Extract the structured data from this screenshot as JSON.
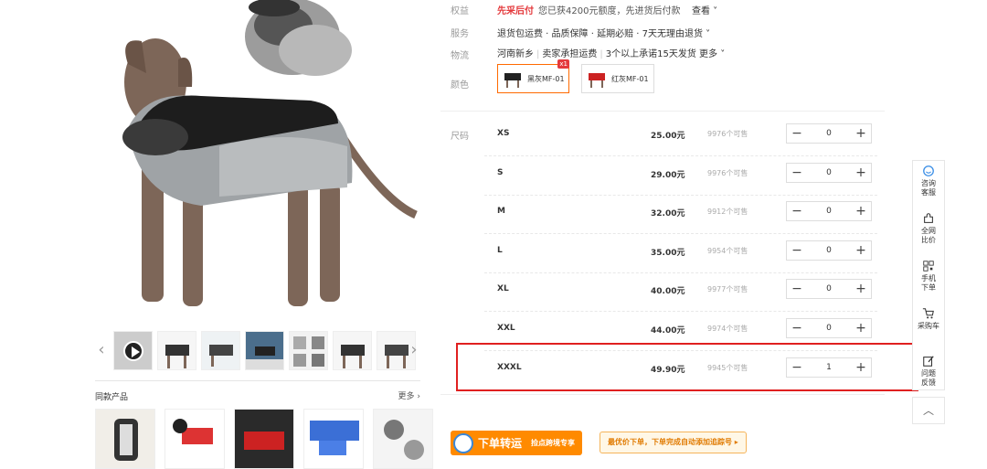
{
  "gallery": {
    "prev_arrow": "‹",
    "next_arrow": "›",
    "thumb_count": 7
  },
  "same_products": {
    "title": "同款产品",
    "more": "更多 ›"
  },
  "info": {
    "rights": {
      "label": "权益",
      "highlight": "先采后付",
      "text": "您已获4200元额度，先进货后付款",
      "link": "查看"
    },
    "service": {
      "label": "服务",
      "text": "退货包运费 · 品质保障 · 延期必赔 · 7天无理由退货"
    },
    "logistics": {
      "label": "物流",
      "place": "河南新乡",
      "fee": "卖家承担运费",
      "promise": "3个以上承诺15天发货",
      "more": "更多"
    },
    "color": {
      "label": "颜色",
      "options": [
        {
          "name": "黑灰MF-01",
          "badge": "x1"
        },
        {
          "name": "红灰MF-01"
        }
      ]
    },
    "size_label": "尺码"
  },
  "sizes": [
    {
      "name": "XS",
      "price": "25.00元",
      "stock": "9976个可售",
      "qty": "0"
    },
    {
      "name": "S",
      "price": "29.00元",
      "stock": "9976个可售",
      "qty": "0"
    },
    {
      "name": "M",
      "price": "32.00元",
      "stock": "9912个可售",
      "qty": "0"
    },
    {
      "name": "L",
      "price": "35.00元",
      "stock": "9954个可售",
      "qty": "0"
    },
    {
      "name": "XL",
      "price": "40.00元",
      "stock": "9977个可售",
      "qty": "0"
    },
    {
      "name": "XXL",
      "price": "44.00元",
      "stock": "9974个可售",
      "qty": "0"
    },
    {
      "name": "XXXL",
      "price": "49.90元",
      "stock": "9945个可售",
      "qty": "1"
    }
  ],
  "stepper": {
    "minus": "−",
    "plus": "+"
  },
  "banner": {
    "title": "下单转运",
    "sub": "捡点跨境专享",
    "tip": "最优价下单，下单完成自动添加追踪号 ▸"
  },
  "sidebar": {
    "items": [
      {
        "label1": "咨询",
        "label2": "客服",
        "icon": "chat-icon"
      },
      {
        "label1": "全网",
        "label2": "比价",
        "icon": "puzzle-icon"
      },
      {
        "label1": "手机",
        "label2": "下单",
        "icon": "qrcode-icon"
      },
      {
        "label1": "采购车",
        "label2": "",
        "icon": "cart-icon"
      },
      {
        "label1": "问题",
        "label2": "反馈",
        "icon": "edit-icon"
      }
    ],
    "top": "︿"
  },
  "colors": {
    "accent": "#e4393c",
    "orange": "#ff6a00",
    "banner": "#ff8a00"
  }
}
